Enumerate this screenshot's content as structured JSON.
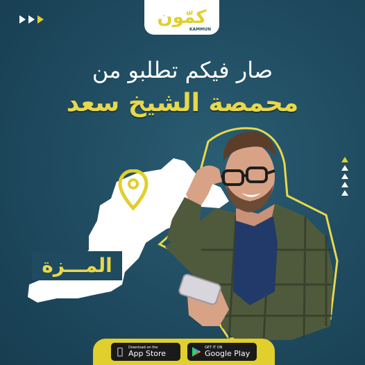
{
  "brand": {
    "logo_text": "كمّون",
    "logo_sub": "KAMMUN"
  },
  "headline": {
    "line1": "صار فيكم تطلبو من",
    "line2": "محمصة الشيخ سعد"
  },
  "map": {
    "area_label": "المـــزة"
  },
  "stores": {
    "apple_small": "Download on the",
    "apple_big": "App Store",
    "google_small": "GET IT ON",
    "google_big": "Google Play"
  },
  "colors": {
    "background": "#1f4a5f",
    "accent": "#e0cf2c",
    "map": "#ffffff"
  }
}
